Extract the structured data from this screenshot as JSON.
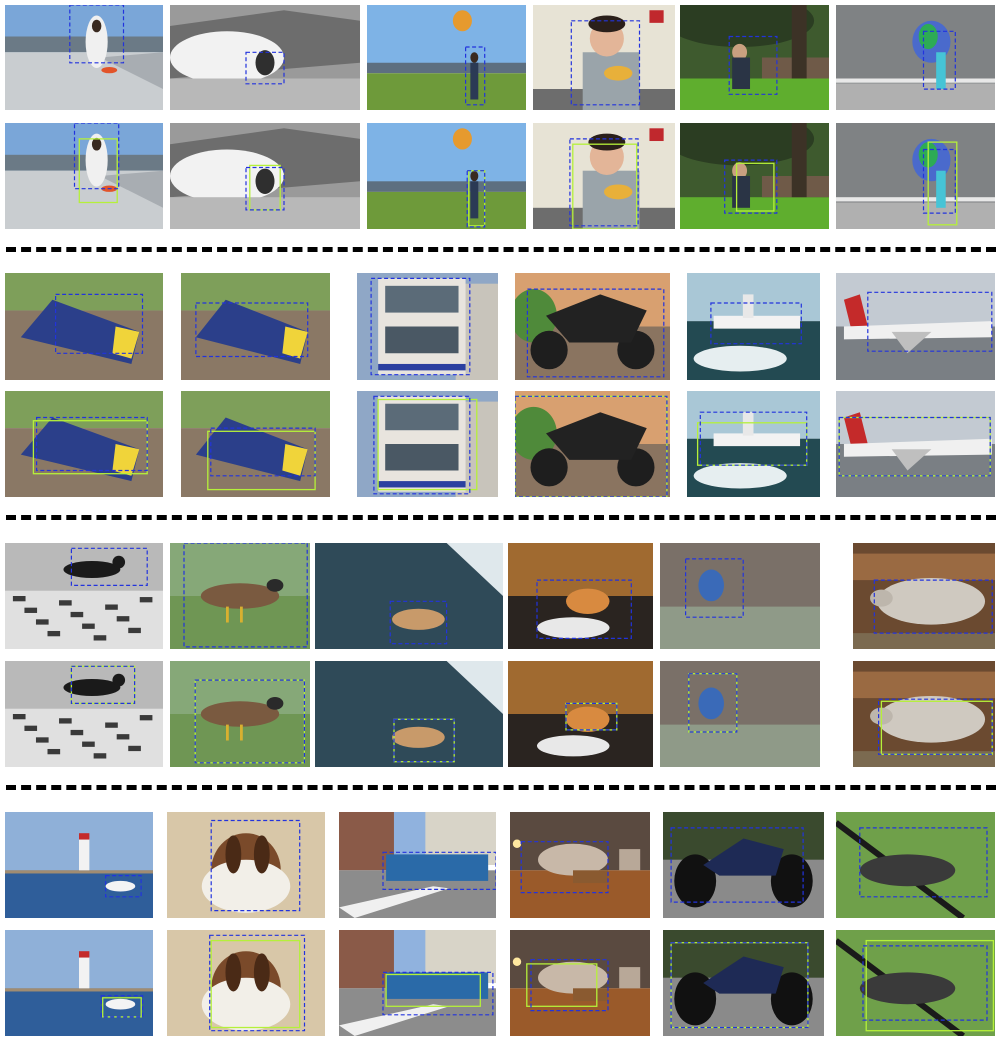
{
  "colors": {
    "predicted_box": "#2233dd",
    "reference_box": "#b5f03a",
    "separator": "#000000"
  },
  "groups": [
    {
      "subjects": [
        "skateboarder",
        "surfer",
        "person-with-kite",
        "man-eating",
        "man-on-bench",
        "girl-with-umbrella"
      ]
    },
    {
      "subjects": [
        "train",
        "train",
        "double-decker-bus",
        "motorbike",
        "ship",
        "airplane"
      ]
    },
    {
      "subjects": [
        "cat",
        "bird",
        "dog",
        "cat",
        "bird",
        "sheep"
      ]
    },
    {
      "subjects": [
        "boat",
        "dog",
        "bus",
        "sofa",
        "motorbike",
        "bird"
      ]
    }
  ]
}
